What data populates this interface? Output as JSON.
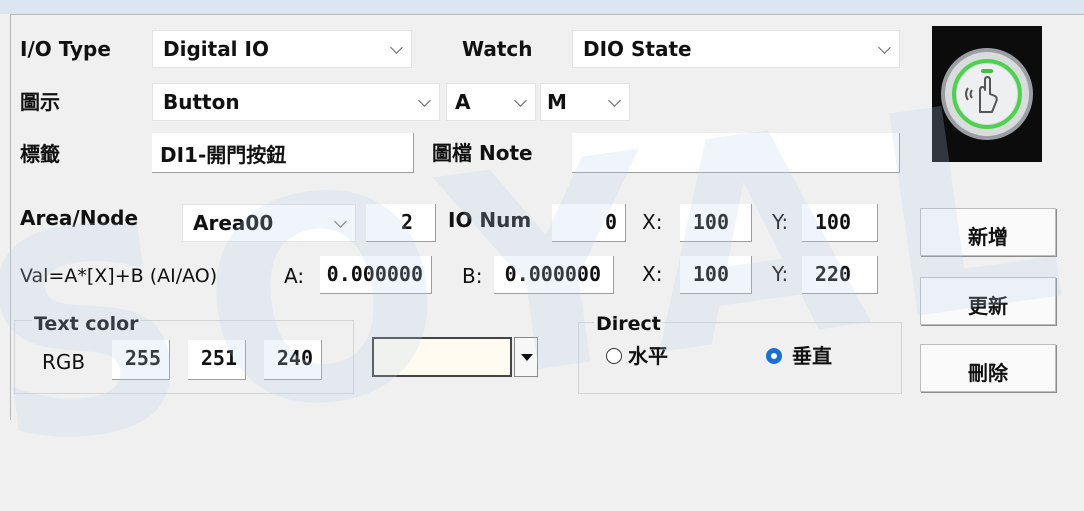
{
  "row1": {
    "io_type_label": "I/O Type",
    "io_type_value": "Digital IO",
    "watch_label": "Watch",
    "watch_value": "DIO State"
  },
  "row2": {
    "icon_label": "圖示",
    "icon_value": "Button",
    "align_a_value": "A",
    "align_m_value": "M"
  },
  "row3": {
    "tag_label": "標籤",
    "tag_value": "DI1-開門按鈕",
    "note_label": "圖檔 Note",
    "note_value": ""
  },
  "row4": {
    "area_label": "Area/Node",
    "area_value": "Area00",
    "node_value": "2",
    "io_num_label": "IO Num",
    "io_num_value": "0",
    "x_label": "X:",
    "x_value": "100",
    "y_label": "Y:",
    "y_value": "100"
  },
  "row5": {
    "formula_label": "Val=A*[X]+B (AI/AO)",
    "a_label": "A:",
    "a_value": "0.000000",
    "b_label": "B:",
    "b_value": "0.000000",
    "x_label": "X:",
    "x_value": "100",
    "y_label": "Y:",
    "y_value": "220"
  },
  "text_color": {
    "title": "Text color",
    "rgb_label": "RGB",
    "r": "255",
    "g": "251",
    "b": "240",
    "swatch": "#fffbf0"
  },
  "direct": {
    "title": "Direct",
    "horizontal_label": "水平",
    "vertical_label": "垂直",
    "selected": "垂直"
  },
  "buttons": {
    "add": "新增",
    "update": "更新",
    "delete": "刪除"
  },
  "watermark": "SOYAL",
  "preview": {
    "icon": "hand-touch-icon",
    "brand": "SOYAL",
    "ring_color": "#4bd34b"
  }
}
